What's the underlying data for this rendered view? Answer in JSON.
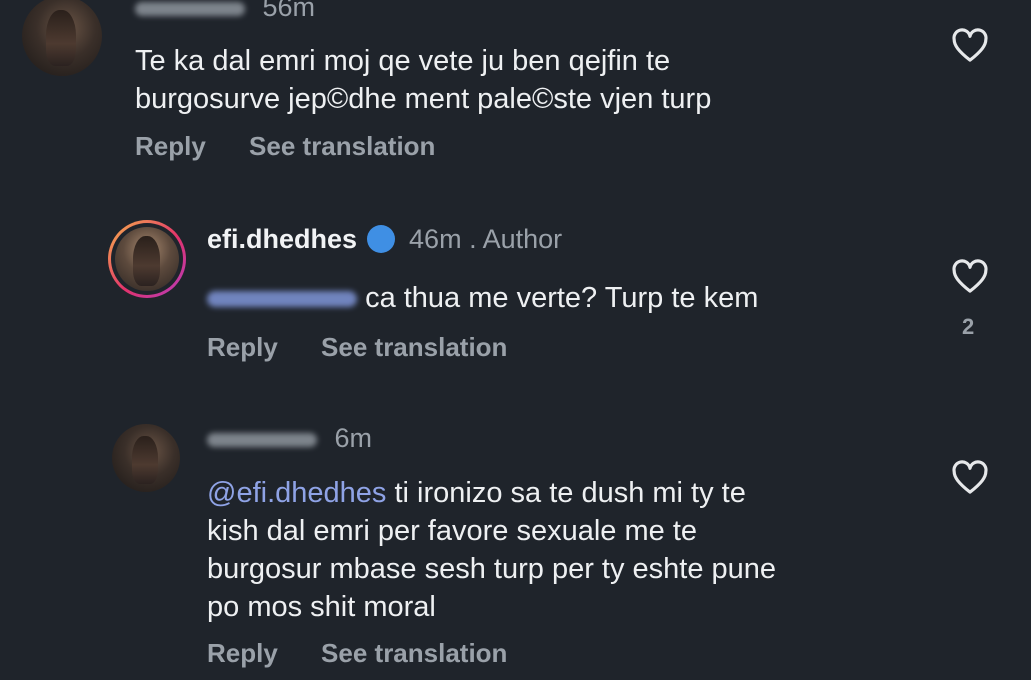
{
  "comments": [
    {
      "time": "56m",
      "text_lines": [
        "Te ka dal emri moj qe vete ju ben qejfin te",
        "burgosurve jep©dhe ment pale©ste vjen turp"
      ],
      "reply_label": "Reply",
      "translate_label": "See translation"
    },
    {
      "username": "efi.dhedhes",
      "time": "46m",
      "author_label": "Author",
      "text_rest": "ca thua me verte? Turp te kem",
      "reply_label": "Reply",
      "translate_label": "See translation",
      "likes": "2"
    },
    {
      "time": "6m",
      "mention": "@efi.dhedhes",
      "text_first_rest": "ti ironizo sa te dush mi ty te",
      "text_lines": [
        "kish dal emri per favore sexuale me te",
        "burgosur mbase sesh turp per ty eshte pune",
        "po mos shit moral"
      ],
      "reply_label": "Reply",
      "translate_label": "See translation"
    }
  ],
  "icons": {
    "like": "heart-outline-icon",
    "verified": "verified-badge-icon"
  },
  "colors": {
    "background": "#1f242b",
    "mention": "#8fa3e6",
    "verified": "#3f8fe4"
  }
}
